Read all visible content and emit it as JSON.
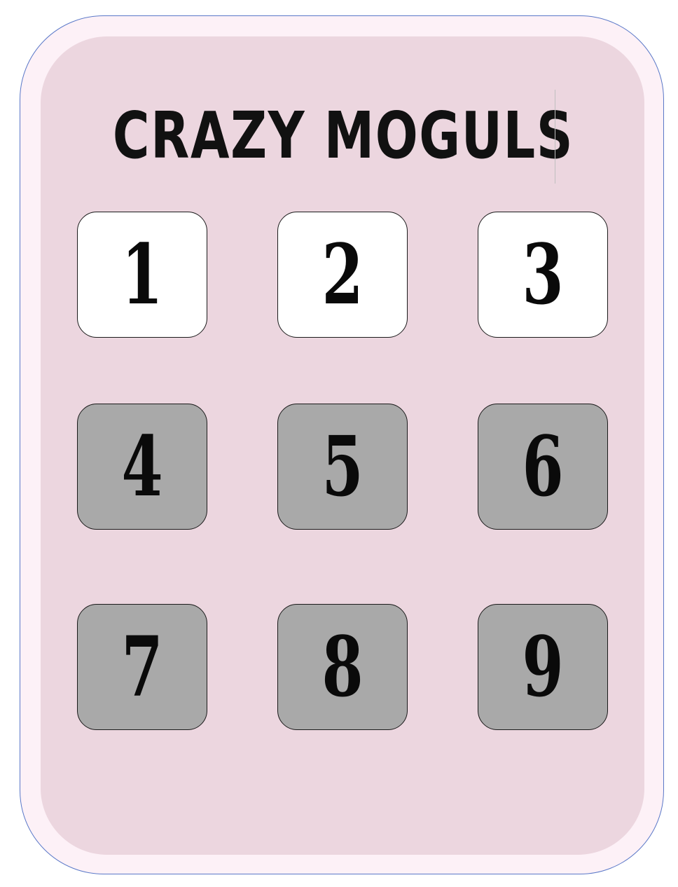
{
  "title": "CRAZY MOGULS",
  "levels": [
    {
      "number": "1",
      "state": "unlocked"
    },
    {
      "number": "2",
      "state": "unlocked"
    },
    {
      "number": "3",
      "state": "unlocked"
    },
    {
      "number": "4",
      "state": "locked"
    },
    {
      "number": "5",
      "state": "locked"
    },
    {
      "number": "6",
      "state": "locked"
    },
    {
      "number": "7",
      "state": "locked"
    },
    {
      "number": "8",
      "state": "locked"
    },
    {
      "number": "9",
      "state": "locked"
    }
  ],
  "colors": {
    "frame_border": "#5a78c8",
    "panel_background": "#ecd6df",
    "unlocked_button": "#ffffff",
    "locked_button": "#a9a9a9",
    "text": "#111111"
  }
}
